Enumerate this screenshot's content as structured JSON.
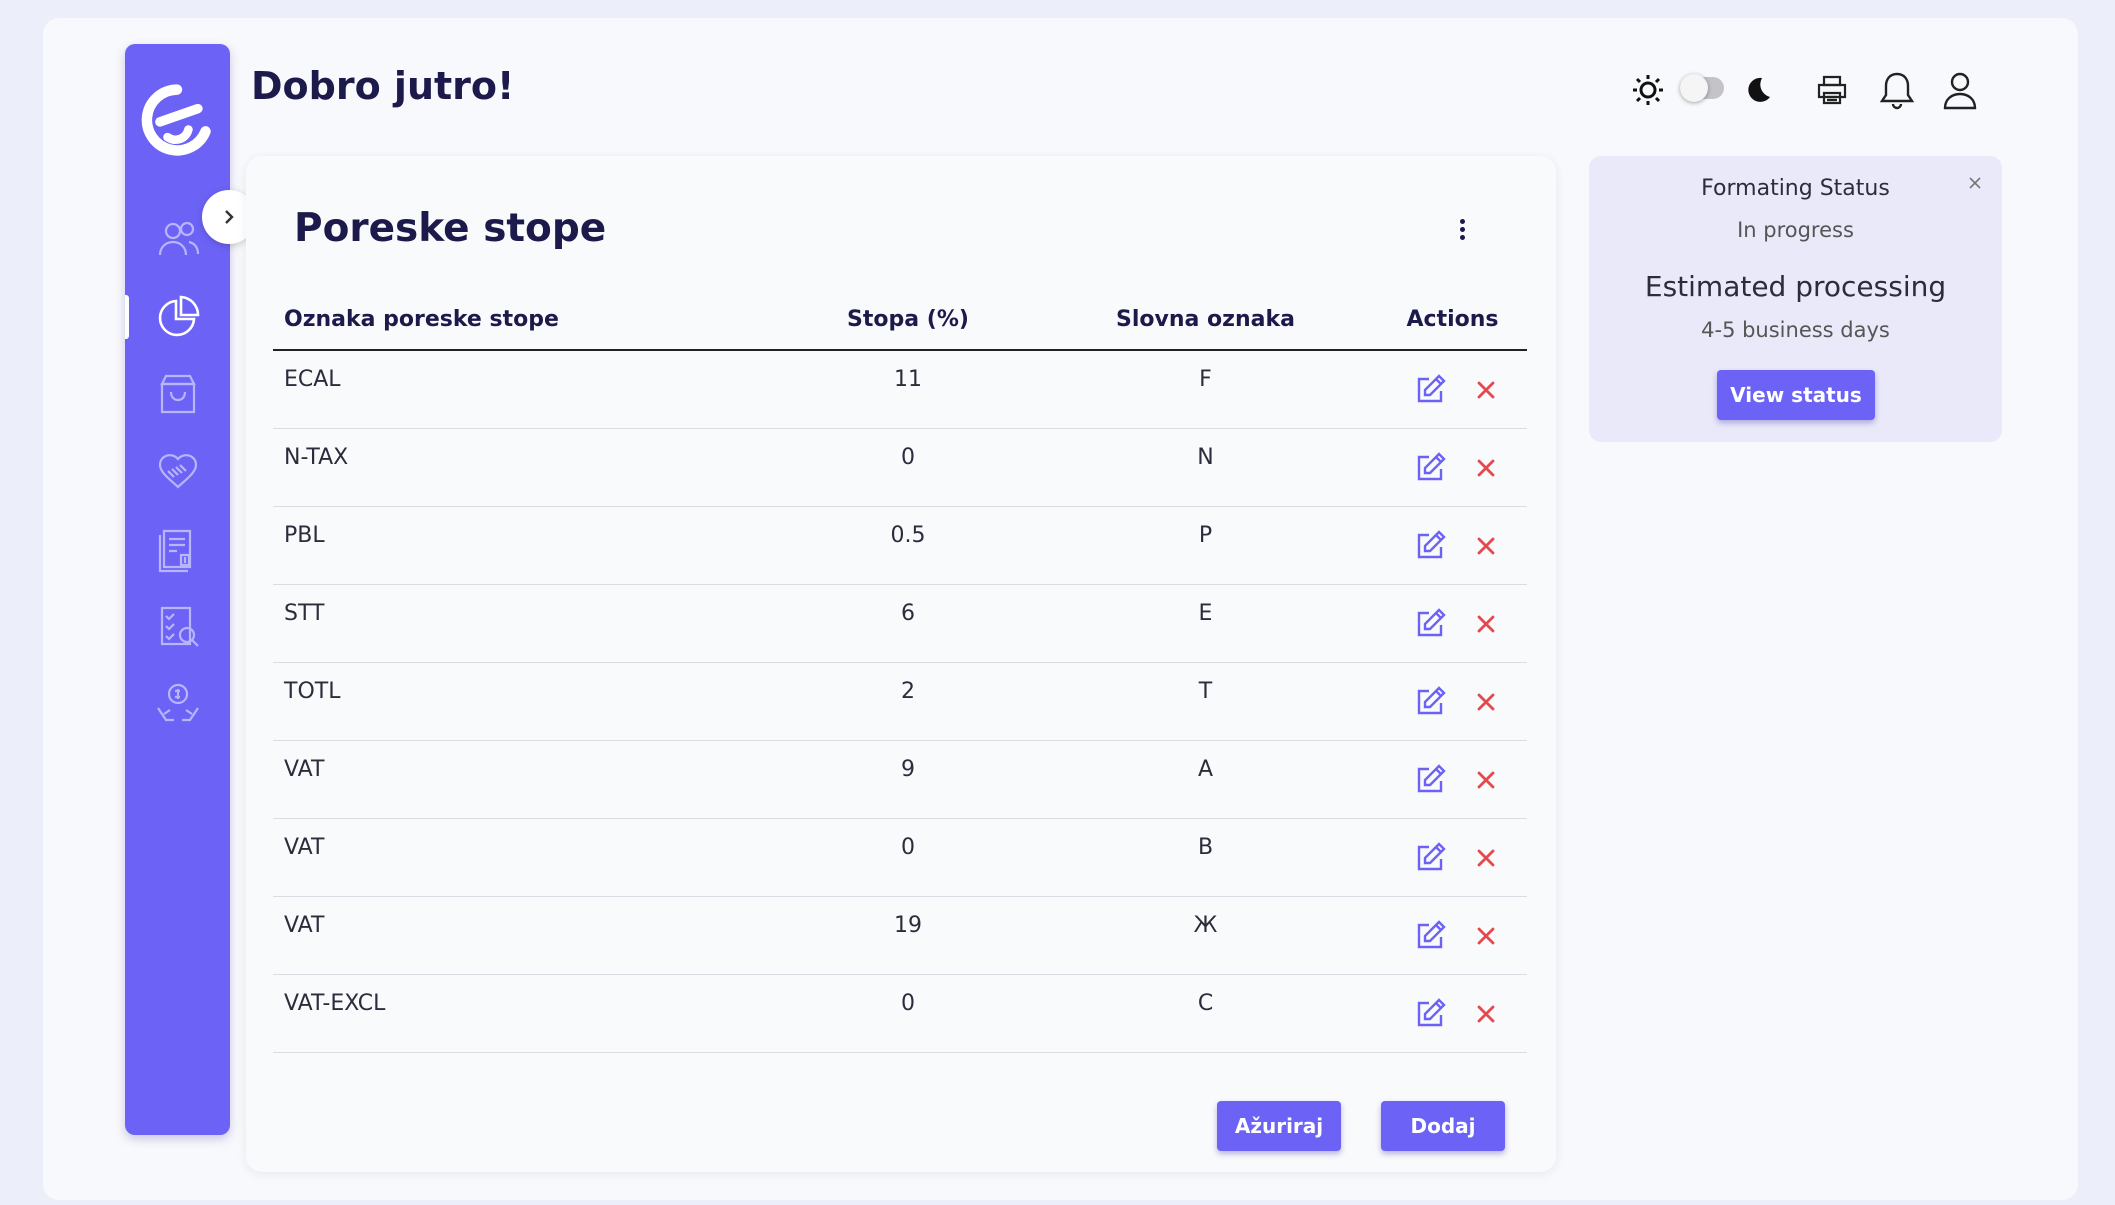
{
  "header": {
    "greeting": "Dobro jutro!"
  },
  "colors": {
    "accent": "#6c63f6",
    "danger": "#e5484d",
    "dark_text": "#1c1a4a"
  },
  "sidebar": {
    "items": [
      {
        "icon": "users-icon"
      },
      {
        "icon": "pie-chart-icon",
        "active": true
      },
      {
        "icon": "shopping-bag-icon"
      },
      {
        "icon": "handshake-icon"
      },
      {
        "icon": "invoice-icon"
      },
      {
        "icon": "checklist-search-icon"
      },
      {
        "icon": "money-hands-icon"
      }
    ]
  },
  "main": {
    "title": "Poreske stope",
    "columns": [
      "Oznaka poreske stope",
      "Stopa (%)",
      "Slovna oznaka",
      "Actions"
    ],
    "rows": [
      {
        "code": "ECAL",
        "rate": "11",
        "letter": "F"
      },
      {
        "code": "N-TAX",
        "rate": "0",
        "letter": "N"
      },
      {
        "code": "PBL",
        "rate": "0.5",
        "letter": "P"
      },
      {
        "code": "STT",
        "rate": "6",
        "letter": "E"
      },
      {
        "code": "TOTL",
        "rate": "2",
        "letter": "T"
      },
      {
        "code": "VAT",
        "rate": "9",
        "letter": "A"
      },
      {
        "code": "VAT",
        "rate": "0",
        "letter": "B"
      },
      {
        "code": "VAT",
        "rate": "19",
        "letter": "Ж"
      },
      {
        "code": "VAT-EXCL",
        "rate": "0",
        "letter": "C"
      }
    ],
    "update_label": "Ažuriraj",
    "add_label": "Dodaj"
  },
  "status_panel": {
    "title": "Formating Status",
    "state": "In progress",
    "estimate_label": "Estimated processing",
    "estimate_value": "4-5 business days",
    "button_label": "View status"
  }
}
